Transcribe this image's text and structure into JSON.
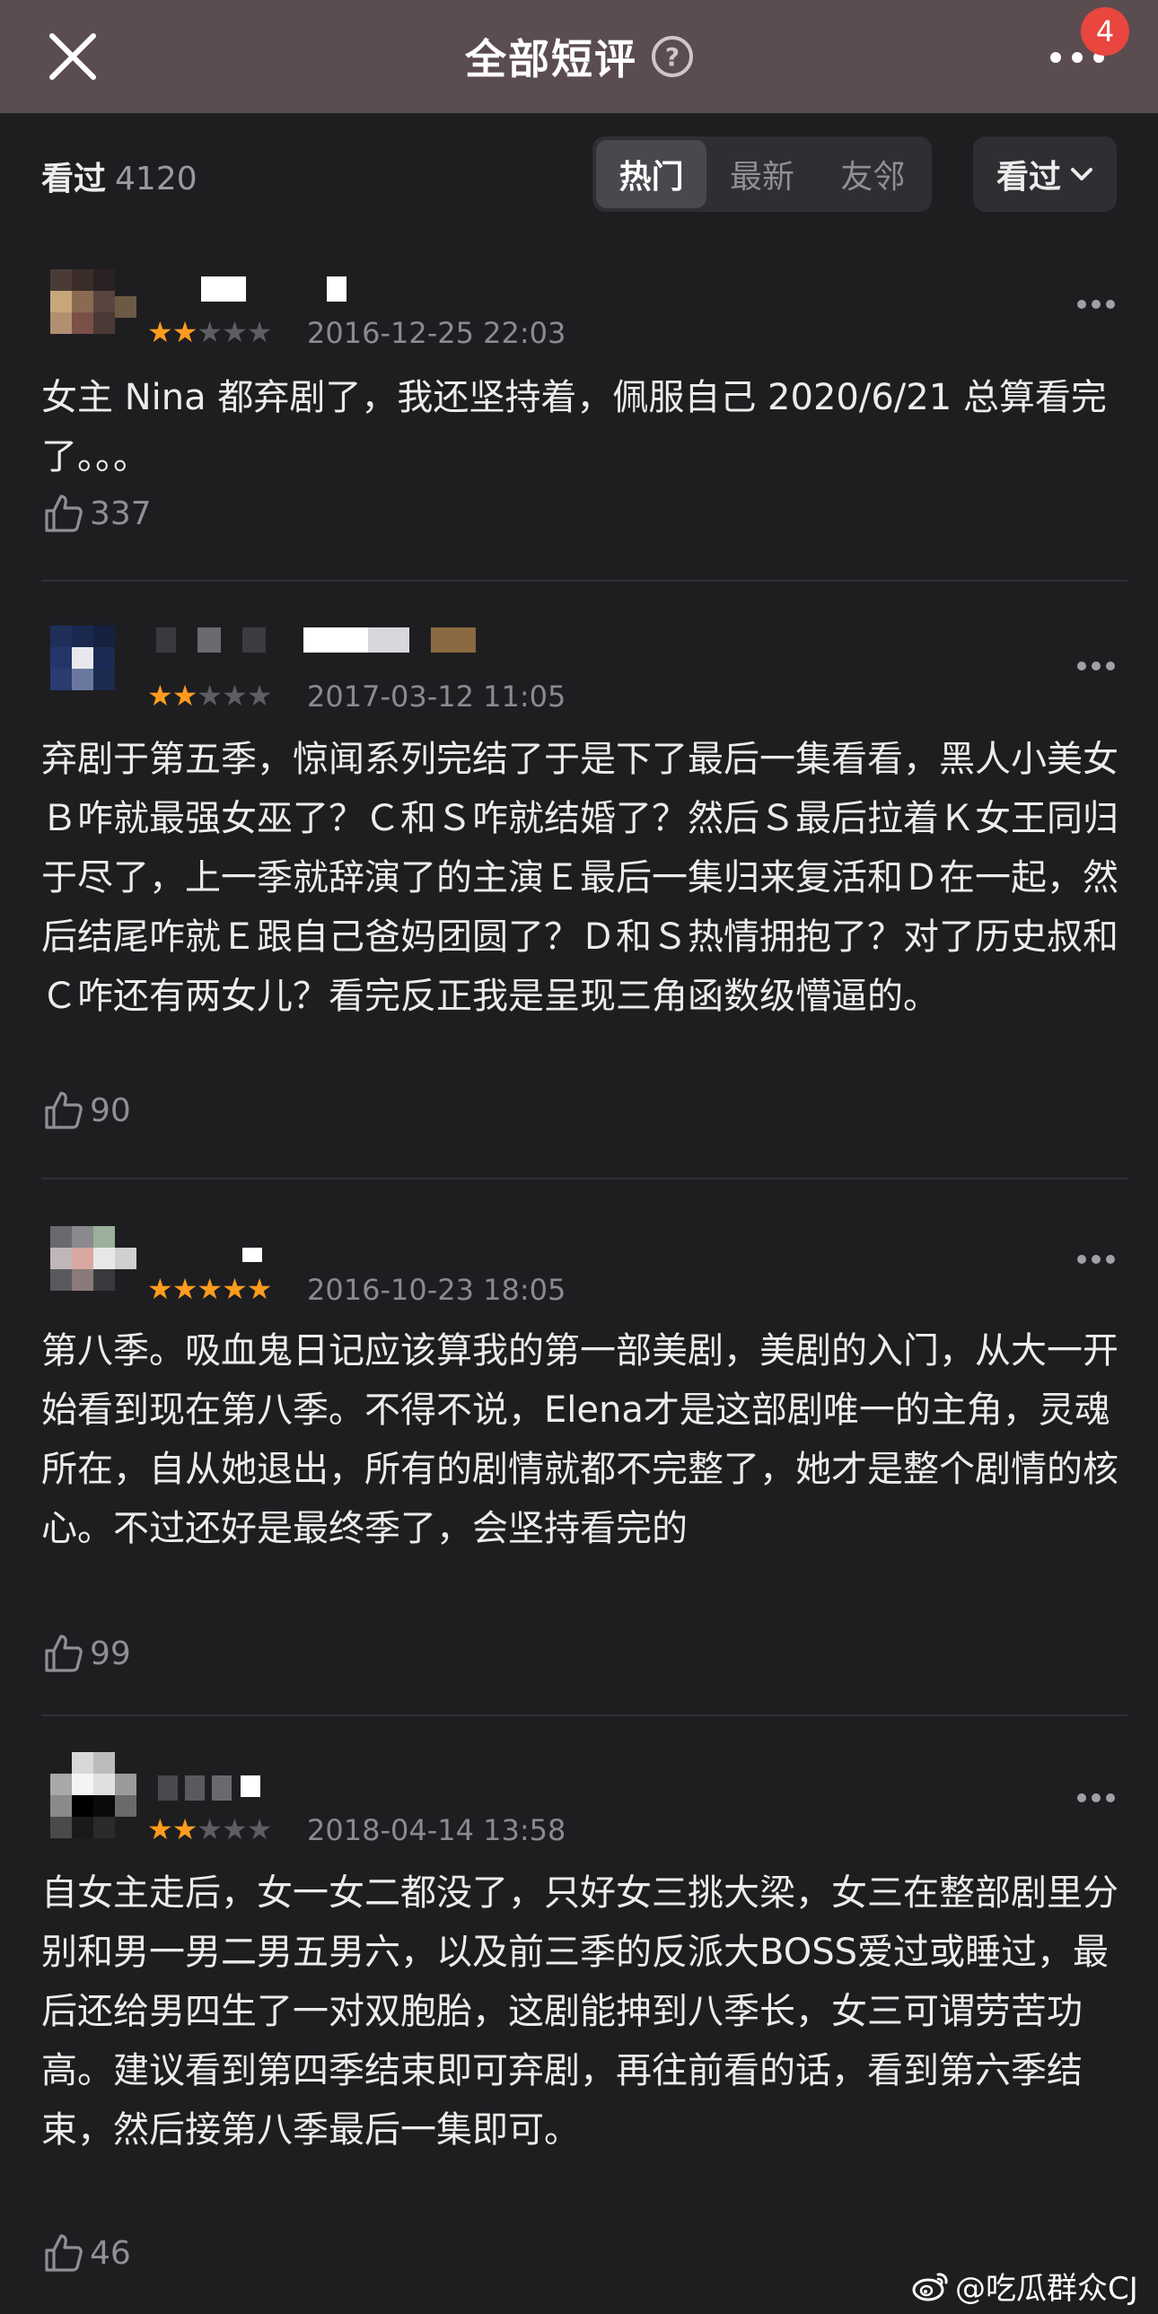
{
  "header": {
    "title": "全部短评",
    "help_glyph": "?",
    "notification_count": "4"
  },
  "filter": {
    "watched_label": "看过",
    "watched_count": "4120",
    "sort_tabs": [
      "热门",
      "最新",
      "友邻"
    ],
    "active_tab": "热门",
    "status_dropdown": "看过"
  },
  "reviews": [
    {
      "rating": 2,
      "time": "2016-12-25 22:03",
      "text": "女主 Nina 都弃剧了，我还坚持着，佩服自己 2020/6/21 总算看完了。。。",
      "likes": "337"
    },
    {
      "rating": 2,
      "time": "2017-03-12 11:05",
      "text": "弃剧于第五季，惊闻系列完结了于是下了最后一集看看，黑人小美女Ｂ咋就最强女巫了？Ｃ和Ｓ咋就结婚了？然后Ｓ最后拉着Ｋ女王同归于尽了，上一季就辞演了的主演Ｅ最后一集归来复活和Ｄ在一起，然后结尾咋就Ｅ跟自己爸妈团圆了？Ｄ和Ｓ热情拥抱了？对了历史叔和Ｃ咋还有两女儿？看完反正我是呈现三角函数级懵逼的。",
      "likes": "90"
    },
    {
      "rating": 5,
      "time": "2016-10-23 18:05",
      "text": "第八季。吸血鬼日记应该算我的第一部美剧，美剧的入门，从大一开始看到现在第八季。不得不说，Elena才是这部剧唯一的主角，灵魂所在，自从她退出，所有的剧情就都不完整了，她才是整个剧情的核心。不过还好是最终季了，会坚持看完的",
      "likes": "99"
    },
    {
      "rating": 2,
      "time": "2018-04-14 13:58",
      "text": "自女主走后，女一女二都没了，只好女三挑大梁，女三在整部剧里分别和男一男二男五男六，以及前三季的反派大BOSS爱过或睡过，最后还给男四生了一对双胞胎，这剧能抻到八季长，女三可谓劳苦功高。建议看到第四季结束即可弃剧，再往前看的话，看到第六季结束，然后接第八季最后一集即可。",
      "likes": "46"
    }
  ],
  "watermark": "@吃瓜群众CJ",
  "colors": {
    "header_bg": "#5b4c4f",
    "page_bg": "#1e1e21",
    "star_on": "#ff9c1f",
    "star_off": "#5d5d62",
    "badge": "#e8463f"
  }
}
